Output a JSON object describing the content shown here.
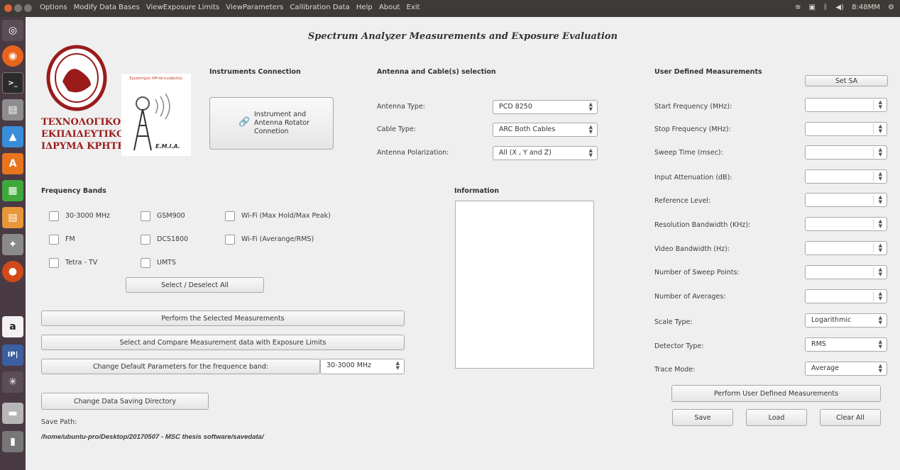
{
  "menubar": {
    "items": [
      "Options",
      "Modify Data Bases",
      "ViewExposure Limits",
      "ViewParameters",
      "Callibration Data",
      "Help",
      "About",
      "Exit"
    ],
    "clock": "8:48MM"
  },
  "app": {
    "title": "Spectrum Analyzer Measurements and Exposure Evaluation"
  },
  "logos": {
    "institute_lines": [
      "ΤΕΧΝΟΛΟΓΙΚΟ",
      "ΕΚΠΑΙΔΕΥΤΙΚΟ",
      "ΙΔΡΥΜΑ ΚΡΗΤΗΣ"
    ],
    "lab_caption": "Εργαστήριο ΗΜ Ακτινοβολίας",
    "lab_name": "Ε.Μ.Ι.Α."
  },
  "instruments": {
    "heading": "Instruments Connection",
    "connect_label_line1": "Instrument and",
    "connect_label_line2": "Antenna Rotator",
    "connect_label_line3": "Connetion"
  },
  "antenna": {
    "heading": "Antenna and Cable(s) selection",
    "antenna_type_label": "Antenna Type:",
    "antenna_type_value": "PCD 8250",
    "cable_type_label": "Cable Type:",
    "cable_type_value": "ARC Both Cables",
    "polarization_label": "Antenna Polarization:",
    "polarization_value": "All (X , Y and Z)"
  },
  "bands": {
    "heading": "Frequency Bands",
    "b1": "30-3000 MHz",
    "b2": "GSM900",
    "b3": "Wi-Fi (Max Hold/Max Peak)",
    "b4": "FM",
    "b5": "DCS1800",
    "b6": "Wi-Fi (Averange/RMS)",
    "b7": "Tetra - TV",
    "b8": "UMTS",
    "select_all": "Select / Deselect All"
  },
  "information": {
    "heading": "Information"
  },
  "actions": {
    "perform": "Perform the Selected Measurements",
    "compare": "Select and Compare Measurement data with Exposure Limits",
    "change_defaults": "Change Default Parameters for the frequence band:",
    "band_value": "30-3000 MHz",
    "change_dir": "Change Data Saving Directory",
    "save_path_label": "Save Path:",
    "save_path": "/home/ubuntu-pro/Desktop/20170507 - MSC thesis software/savedata/"
  },
  "user": {
    "heading": "User Defined Measurements",
    "set_sa": "Set SA",
    "start_freq": "Start Frequency (MHz):",
    "stop_freq": "Stop Frequency (MHz):",
    "sweep_time": "Sweep Time (msec):",
    "input_att": "Input Attenuation (dB):",
    "ref_level": "Reference Level:",
    "rbw": "Resolution Bandwidth (KHz):",
    "vbw": "Video Bandwidth (Hz):",
    "sweep_points": "Number of Sweep Points:",
    "averages": "Number of Averages:",
    "scale_type": "Scale Type:",
    "scale_value": "Logarithmic",
    "detector_type": "Detector Type:",
    "detector_value": "RMS",
    "trace_mode": "Trace Mode:",
    "trace_value": "Average",
    "perform_user": "Perform User Defined Measurements",
    "save": "Save",
    "load": "Load",
    "clear": "Clear All"
  }
}
